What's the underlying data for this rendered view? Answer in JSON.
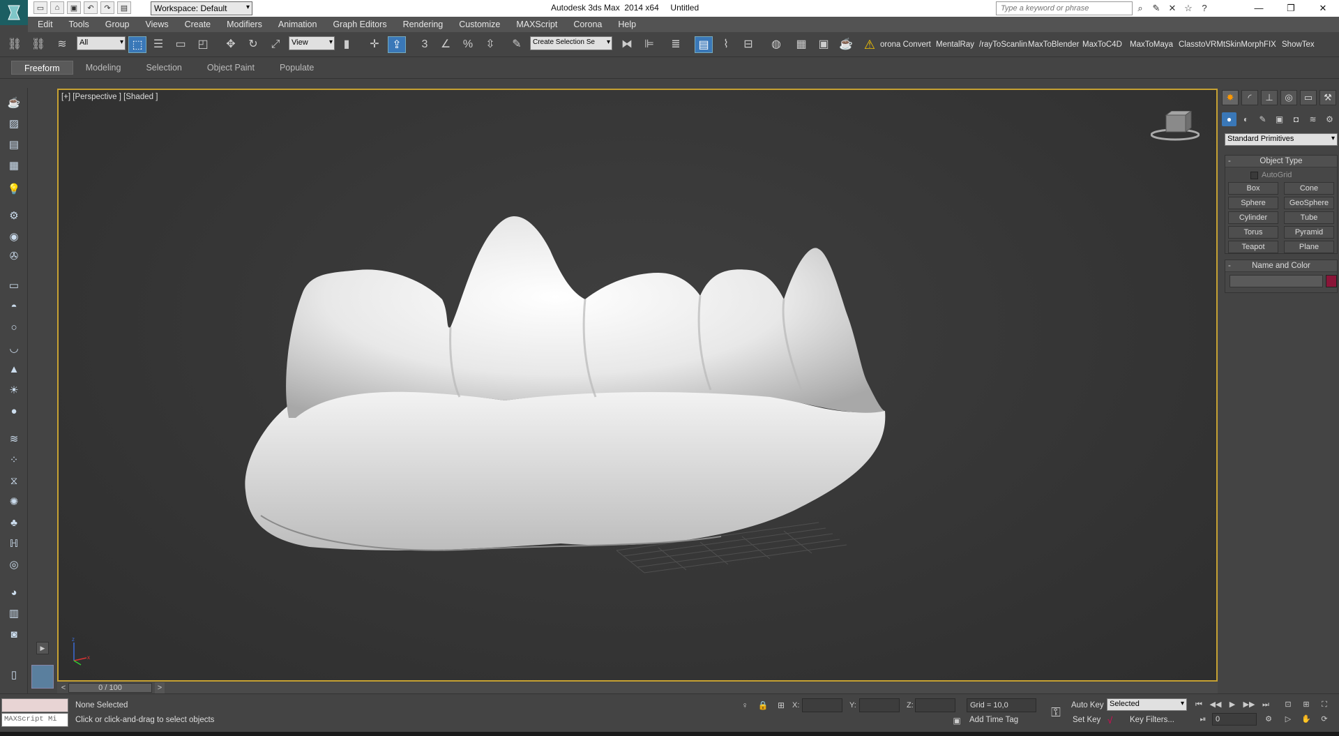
{
  "titlebar": {
    "logo": "3ds-max-logo",
    "workspace_value": "Workspace: Default",
    "title": "Autodesk 3ds Max  2014 x64     Untitled",
    "search_placeholder": "Type a keyword or phrase",
    "window_controls": [
      "—",
      "❐",
      "✕"
    ]
  },
  "menu": [
    "Edit",
    "Tools",
    "Group",
    "Views",
    "Create",
    "Modifiers",
    "Animation",
    "Graph Editors",
    "Rendering",
    "Customize",
    "MAXScript",
    "Corona",
    "Help"
  ],
  "toolbar": {
    "selection_filter": "All",
    "ref_coord": "View",
    "named_selection": "Create Selection Se",
    "plugins": [
      "orona Convert",
      "MentalRay",
      "/rayToScanlin",
      "MaxToBlender",
      "MaxToC4D",
      "MaxToMaya",
      "ClasstoVRMt",
      "SkinMorphFIX",
      "ShowTex"
    ]
  },
  "ribbon": {
    "tabs": [
      "Freeform",
      "Modeling",
      "Selection",
      "Object Paint",
      "Populate"
    ],
    "active_tab": "Freeform"
  },
  "viewport": {
    "label": "[+] [Perspective ] [Shaded ]",
    "active_border_color": "#c7a233",
    "model": "teeth-model"
  },
  "command_panel": {
    "category": "Standard Primitives",
    "object_type_title": "Object Type",
    "autogrid_label": "AutoGrid",
    "primitives": [
      "Box",
      "Cone",
      "Sphere",
      "GeoSphere",
      "Cylinder",
      "Tube",
      "Torus",
      "Pyramid",
      "Teapot",
      "Plane"
    ],
    "name_color_title": "Name and Color",
    "object_color": "#8a1538"
  },
  "time_slider": {
    "frame_readout": "0 / 100",
    "prev": "<",
    "next": ">"
  },
  "status": {
    "maxscript_label": "MAXScript Mi",
    "selection": "None Selected",
    "prompt": "Click or click-and-drag to select objects",
    "x_label": "X:",
    "y_label": "Y:",
    "z_label": "Z:",
    "grid": "Grid = 10,0",
    "add_time_tag": "Add Time Tag",
    "auto_key": "Auto Key",
    "key_mode": "Selected",
    "set_key": "Set Key",
    "key_filters": "Key Filters...",
    "current_frame": "0"
  }
}
